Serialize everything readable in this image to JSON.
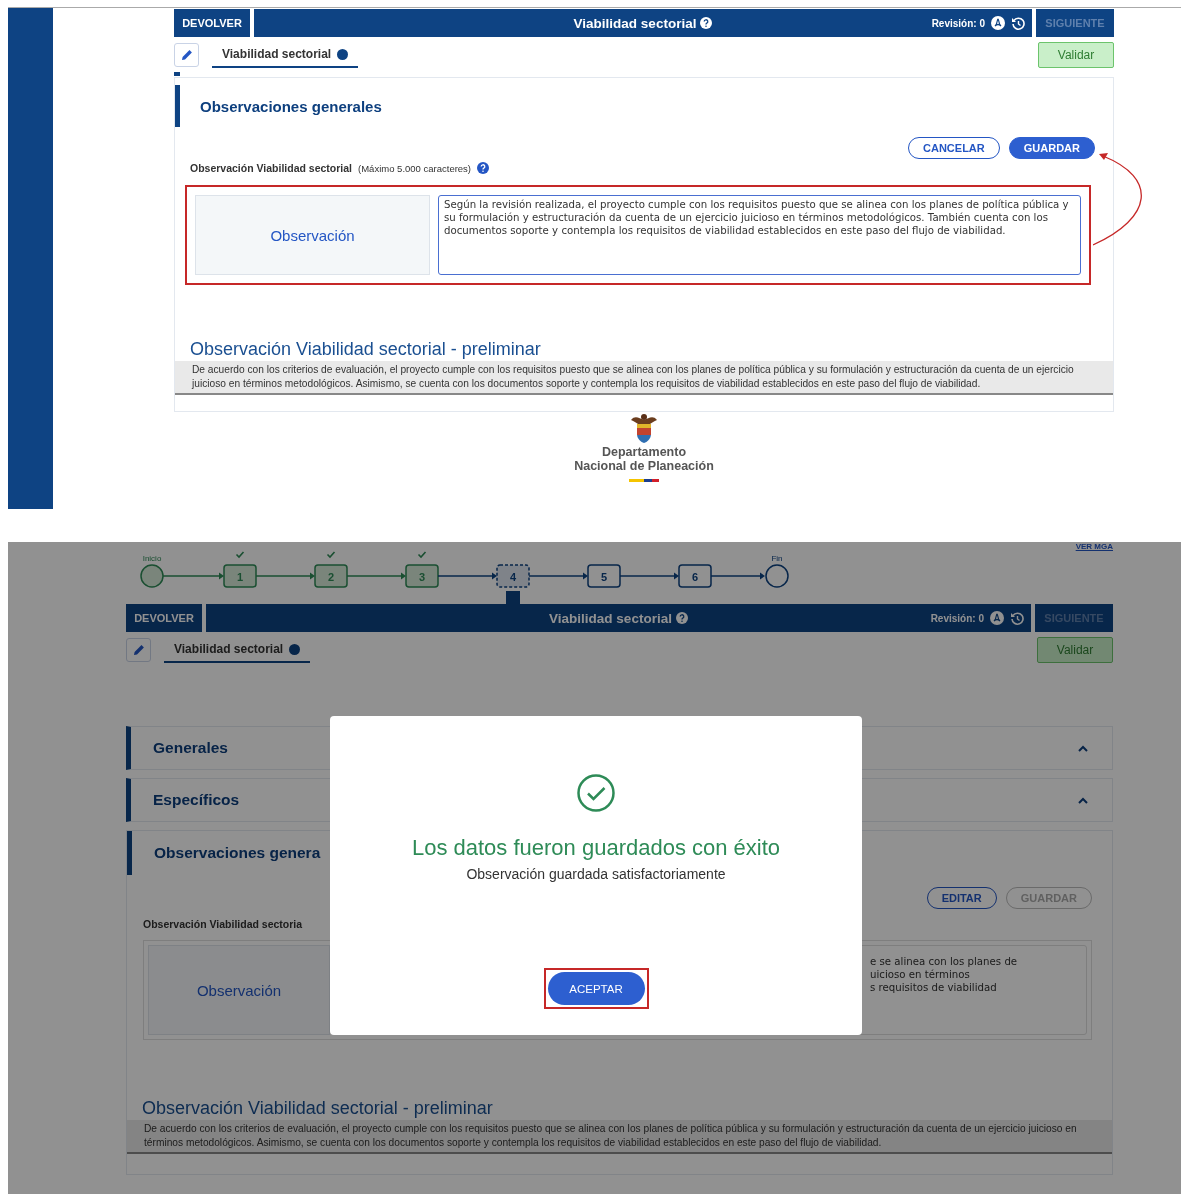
{
  "top_screen": {
    "header": {
      "back_button": "DEVOLVER",
      "title": "Viabilidad sectorial",
      "revision": "Revisión: 0",
      "next_button": {
        "label": "SIGUIENTE",
        "disabled": true
      }
    },
    "tab": {
      "label": "Viabilidad sectorial",
      "selected": true
    },
    "validate_button": "Validar",
    "section": {
      "title": "Observaciones generales",
      "expanded": true,
      "actions": [
        {
          "label": "CANCELAR",
          "kind": "outline",
          "disabled": false
        },
        {
          "label": "GUARDAR",
          "kind": "filled",
          "disabled": false
        }
      ],
      "field_label": "Observación Viabilidad sectorial",
      "field_hint": "(Máximo 5.000 caracteres)",
      "observation_label": "Observación",
      "highlighted": true,
      "observation_text": [
        "Según la revisión realizada, el proyecto cumple con los requisitos puesto que se alinea con los planes de política pública y su formulación y estructuración da cuenta de un ejercicio juicioso en términos metodológicos. También cuenta con los documentos soporte y contempla los requisitos de viabilidad establecidos en este paso del flujo de viabilidad."
      ]
    },
    "preliminary": {
      "title": "Observación Viabilidad sectorial - preliminar",
      "text": "De acuerdo con los criterios de evaluación, el proyecto cumple con los requisitos puesto que se alinea con los planes de política pública y su formulación y estructuración da cuenta de un ejercicio juicioso en términos metodológicos. Asimismo, se cuenta con los documentos soporte y contempla los requisitos de viabilidad establecidos en este paso del flujo de viabilidad."
    },
    "footer_logo": {
      "line_1": "Departamento",
      "line_2": "Nacional de Planeación"
    }
  },
  "bottom_screen": {
    "link": "VER MGA",
    "stepper": {
      "start_label": "Inicio",
      "end_label": "Fin",
      "steps": [
        {
          "label": "1",
          "done": true,
          "current": false
        },
        {
          "label": "2",
          "done": true,
          "current": false
        },
        {
          "label": "3",
          "done": true,
          "current": false
        },
        {
          "label": "4",
          "done": false,
          "current": true
        },
        {
          "label": "5",
          "done": false,
          "current": false
        },
        {
          "label": "6",
          "done": false,
          "current": false
        }
      ]
    },
    "header": {
      "back_button": "DEVOLVER",
      "title": "Viabilidad sectorial",
      "revision": "Revisión: 0",
      "next_button": {
        "label": "SIGUIENTE",
        "disabled": true
      }
    },
    "tab": {
      "label": "Viabilidad sectorial",
      "selected": true
    },
    "validate_button": "Validar",
    "accordions": [
      {
        "title": "Generales",
        "expanded": false
      },
      {
        "title": "Específicos",
        "expanded": false
      }
    ],
    "section": {
      "title": "Observaciones genera",
      "expanded": true,
      "actions": [
        {
          "label": "EDITAR",
          "kind": "outline",
          "disabled": false
        },
        {
          "label": "GUARDAR",
          "kind": "filled",
          "disabled": true
        }
      ],
      "field_label": "Observación Viabilidad sectoria",
      "observation_label": "Observación",
      "observation_text": [
        "e se alinea con los planes de",
        "uicioso en términos",
        "s requisitos de viabilidad"
      ]
    },
    "preliminary": {
      "title": "Observación Viabilidad sectorial - preliminar",
      "text": "De acuerdo con los criterios de evaluación, el proyecto cumple con los requisitos puesto que se alinea con los planes de política pública y su formulación y estructuración da cuenta de un ejercicio juicioso en términos metodológicos. Asimismo, se cuenta con los documentos soporte y contempla los requisitos de viabilidad establecidos en este paso del flujo de viabilidad."
    },
    "dialog": {
      "title": "Los datos fueron guardados con éxito",
      "message": "Observación guardada satisfactoriamente",
      "button": "ACEPTAR",
      "highlighted": true
    }
  }
}
